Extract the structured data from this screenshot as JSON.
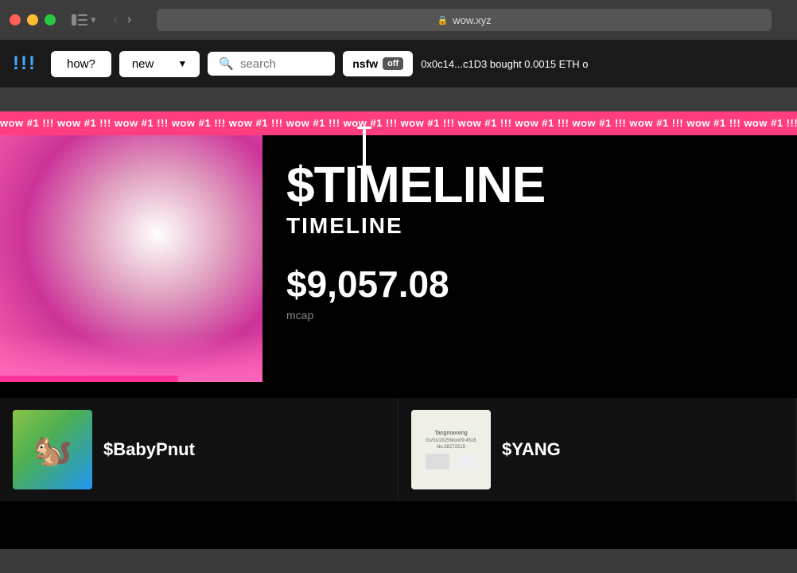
{
  "browser": {
    "url": "wow.xyz",
    "window_controls": {
      "close_color": "#ff5f57",
      "minimize_color": "#febc2e",
      "maximize_color": "#28c840"
    }
  },
  "nav": {
    "logo": "!!!",
    "how_label": "how?",
    "dropdown_label": "new",
    "search_placeholder": "search",
    "nsfw_label": "nsfw",
    "nsfw_state": "off",
    "ticker_text": "0x0c14...c1D3 bought 0.0015 ETH o"
  },
  "marquee": {
    "text": "wow #1 !!! wow #1 !!! wow #1 !!! wow #1 !!! wow #1 !!! wow #1 !!! wow #1 !!! wow #1 !!! wow #1 !!! wow #1 !!! wow #1 !!! wow #1 !!! wow #1 !!! wow #1 !!! wow #1 !!! wow #1 !!! "
  },
  "featured": {
    "token_symbol": "$TIMELINE",
    "token_name": "TIMELINE",
    "mcap": "$9,057.08",
    "mcap_label": "mcap"
  },
  "bottom_cards": [
    {
      "token_symbol": "$BabyPnut",
      "image_type": "baby"
    },
    {
      "token_symbol": "$YANG",
      "image_type": "yang"
    }
  ]
}
